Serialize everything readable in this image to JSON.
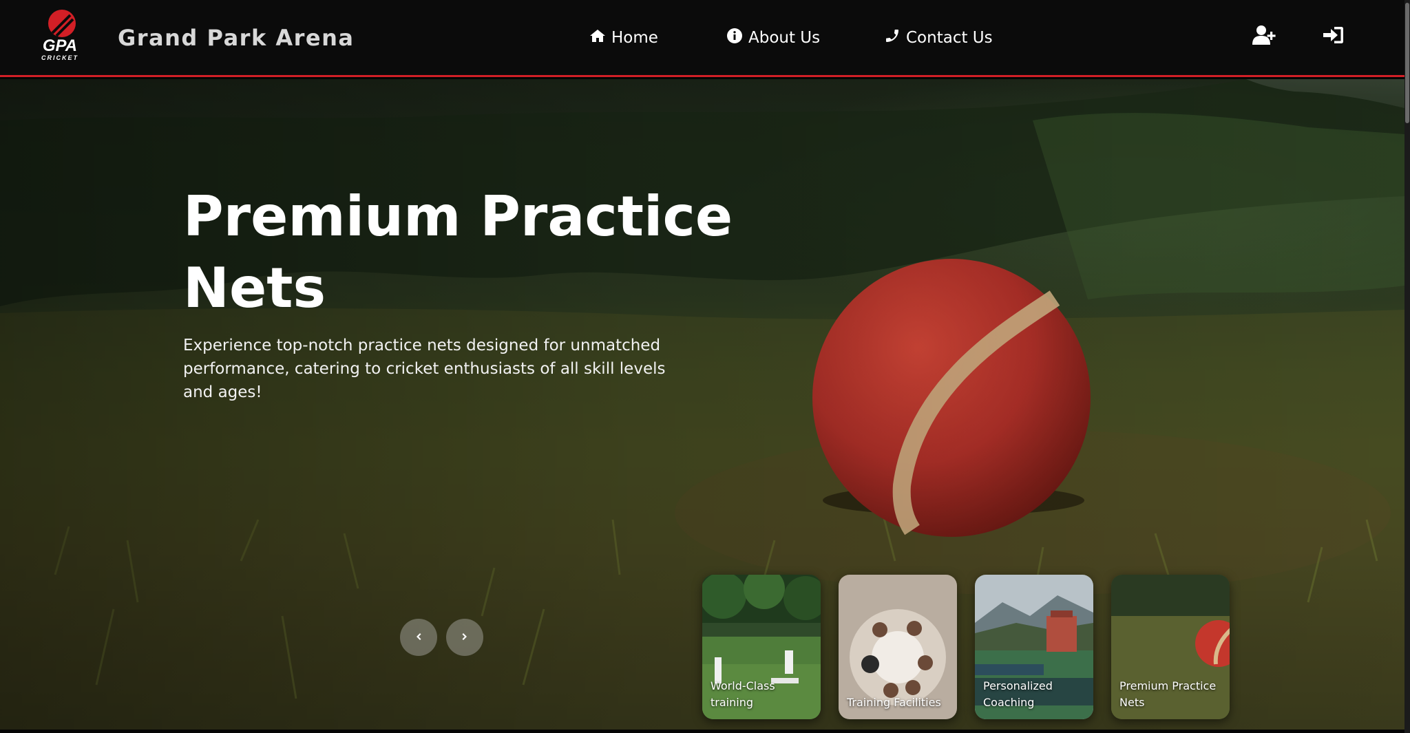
{
  "header": {
    "logo_text": "GPA",
    "logo_subtext": "CRICKET",
    "brand": "Grand Park Arena",
    "nav": [
      {
        "label": "Home",
        "icon": "home-icon"
      },
      {
        "label": "About Us",
        "icon": "info-icon"
      },
      {
        "label": "Contact Us",
        "icon": "phone-icon"
      }
    ],
    "actions": [
      {
        "name": "register",
        "icon": "user-plus-icon"
      },
      {
        "name": "login",
        "icon": "sign-in-icon"
      }
    ]
  },
  "hero": {
    "title_line1": "Premium Practice",
    "title_line2": "Nets",
    "description": "Experience top-notch practice nets designed for unmatched performance, catering to cricket enthusiasts of all skill levels and ages!"
  },
  "slider": {
    "prev_icon": "chevron-left-icon",
    "next_icon": "chevron-right-icon"
  },
  "cards": [
    {
      "label": "World-Class training"
    },
    {
      "label": "Training Facilities"
    },
    {
      "label": "Personalized Coaching"
    },
    {
      "label": "Premium Practice Nets"
    }
  ],
  "colors": {
    "accent": "#d21f26",
    "nav_bg": "#0b0b0b",
    "ball": "#c8382c"
  }
}
